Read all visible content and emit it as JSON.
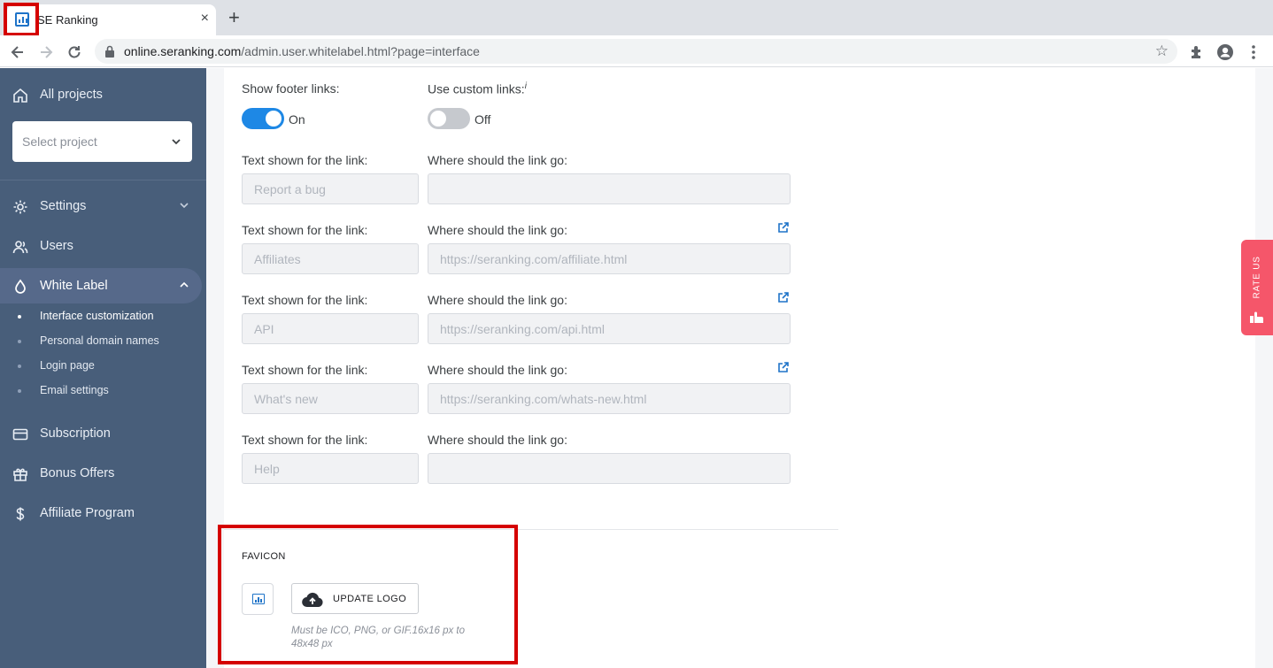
{
  "browser": {
    "tab_title": "SE Ranking",
    "tab_close": "×",
    "new_tab": "+",
    "url_host": "online.seranking.com",
    "url_path": "/admin.user.whitelabel.html?page=interface",
    "star": "☆"
  },
  "sidebar": {
    "all_projects": "All projects",
    "select_project_placeholder": "Select project",
    "settings": "Settings",
    "users": "Users",
    "white_label": "White Label",
    "sub_items": [
      "Interface customization",
      "Personal domain names",
      "Login page",
      "Email settings"
    ],
    "subscription": "Subscription",
    "bonus_offers": "Bonus Offers",
    "affiliate_program": "Affiliate Program"
  },
  "footer_links": {
    "show_footer_label": "Show footer links:",
    "show_footer_state": "On",
    "custom_links_label": "Use custom links:",
    "custom_links_info": "i",
    "custom_links_state": "Off",
    "text_label": "Text shown for the link:",
    "where_label": "Where should the link go:",
    "rows": [
      {
        "text": "Report a bug",
        "url": "",
        "external": false
      },
      {
        "text": "Affiliates",
        "url": "https://seranking.com/affiliate.html",
        "external": true
      },
      {
        "text": "API",
        "url": "https://seranking.com/api.html",
        "external": true
      },
      {
        "text": "What's new",
        "url": "https://seranking.com/whats-new.html",
        "external": true
      },
      {
        "text": "Help",
        "url": "",
        "external": false
      }
    ]
  },
  "favicon": {
    "title": "FAVICON",
    "button_label": "UPDATE LOGO",
    "hint": "Must be ICO, PNG, or GIF.16x16 px to 48x48 px"
  },
  "rate_us": "RATE US",
  "colors": {
    "sidebar_bg": "#485e7a",
    "accent_blue": "#1e88e5",
    "highlight_red": "#d50000",
    "rate_us_bg": "#f5566a"
  }
}
